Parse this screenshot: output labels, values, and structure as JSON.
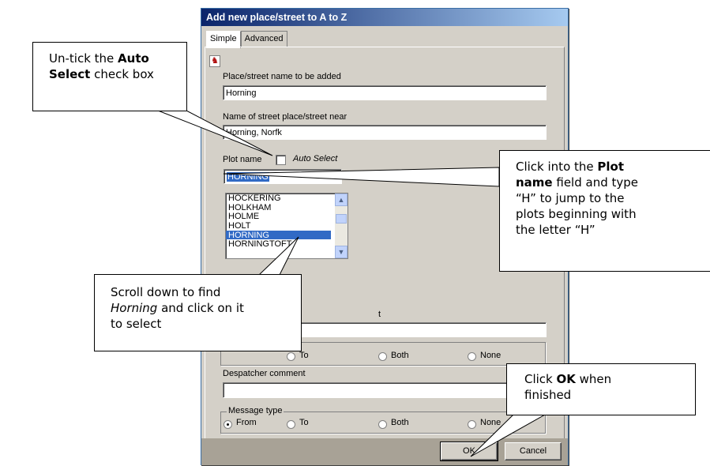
{
  "dialog": {
    "title": "Add new place/street to A to Z",
    "tabs": [
      "Simple",
      "Advanced"
    ],
    "place_label": "Place/street name to be added",
    "place_value": "Horning",
    "near_label": "Name of street place/street near",
    "near_value": "Horning, Norfk",
    "plot_label": "Plot name",
    "auto_select_label": "Auto Select",
    "plot_value": "HORNING",
    "plot_list": [
      "HOCKERING",
      "HOLKHAM",
      "HOLME",
      "HOLT",
      "HORNING",
      "HORNINGTOFT"
    ],
    "plot_selected_index": 4,
    "group1_radios": [
      "To",
      "Both",
      "None"
    ],
    "despatcher_label": "Despatcher comment",
    "message_type_label": "Message type",
    "message_radios": [
      "From",
      "To",
      "Both",
      "None"
    ],
    "ok_label": "OK",
    "cancel_label": "Cancel",
    "partial_label_t": "t"
  },
  "callouts": {
    "c1_pre": "Un-tick the ",
    "c1_bold1": "Auto",
    "c1_bold2": "Select",
    "c1_post": " check box",
    "c2_pre": "Click into the ",
    "c2_bold1": "Plot",
    "c2_bold2": "name",
    "c2_mid": " field and type",
    "c2_line3": "“H” to jump to the",
    "c2_line4": "plots beginning with",
    "c2_line5": "the letter “H”",
    "c3_line1": "Scroll down to find",
    "c3_italic": "Horning",
    "c3_mid": " and click on it",
    "c3_line3": "to select",
    "c4_pre": "Click ",
    "c4_bold": "OK",
    "c4_post": " when",
    "c4_line2": "finished"
  },
  "icons": {
    "flag": "red-pin-icon",
    "scroll_up": "scroll-up-arrow-icon",
    "scroll_down": "scroll-down-arrow-icon"
  }
}
